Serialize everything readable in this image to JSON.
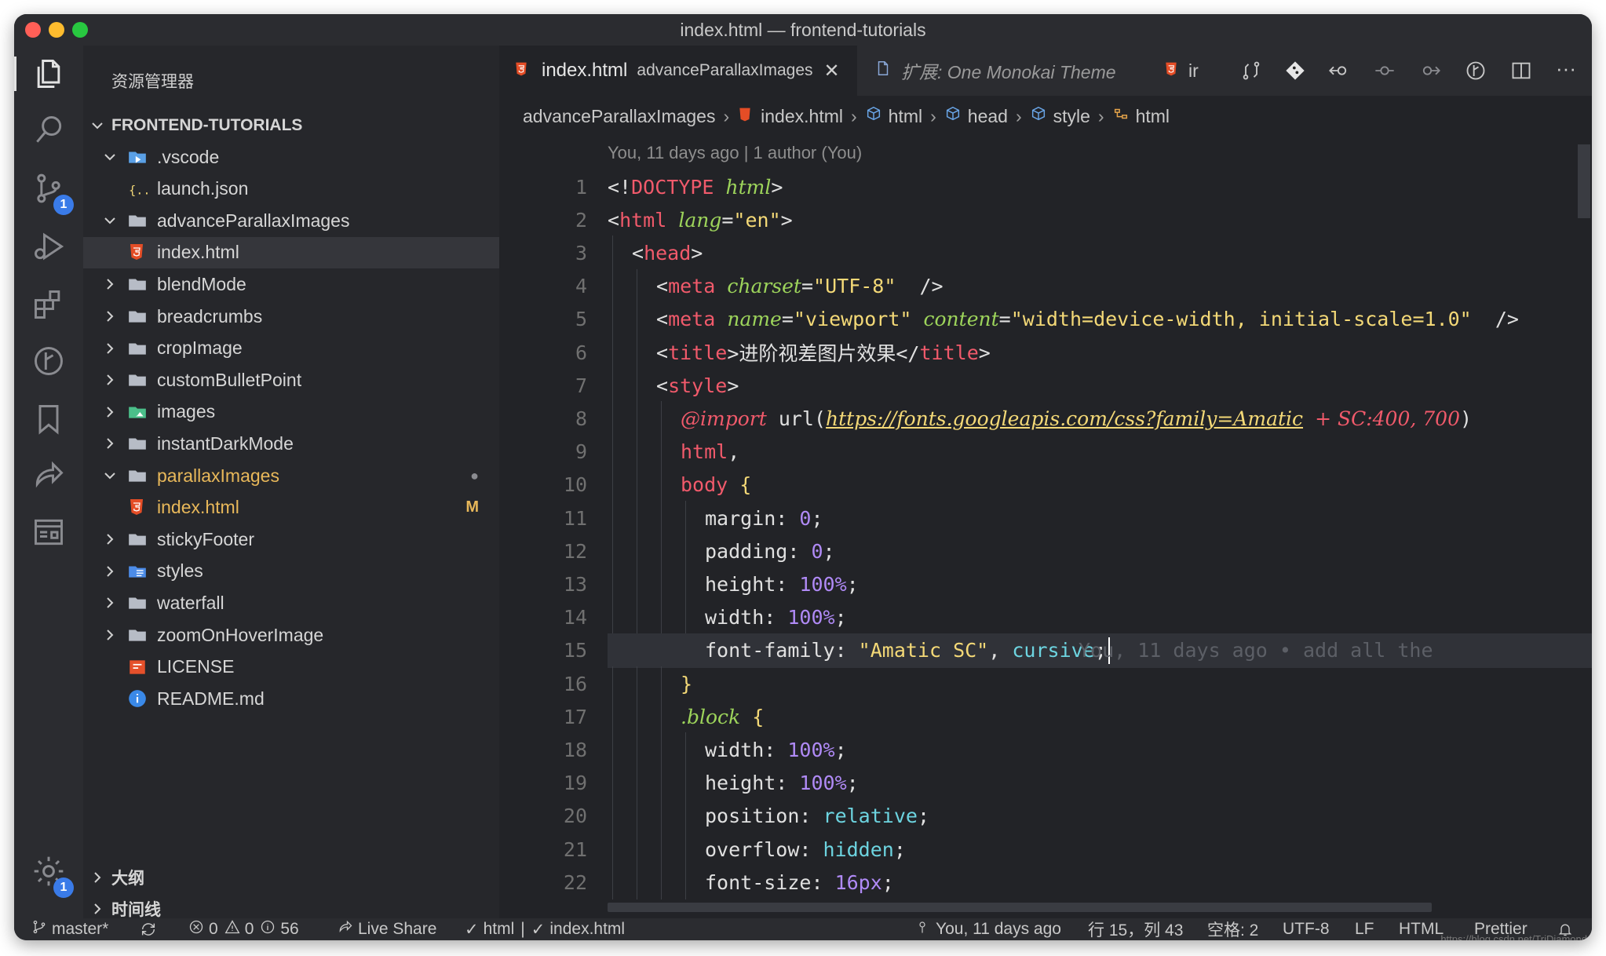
{
  "window": {
    "title": "index.html — frontend-tutorials"
  },
  "colors": {
    "accent": "#3a7be8",
    "traffic_red": "#ff5f57",
    "traffic_yellow": "#febc2e",
    "traffic_green": "#28c840",
    "html_icon": "#e44d26"
  },
  "activity": {
    "items": [
      "files-icon",
      "search-icon",
      "source-control-icon",
      "run-debug-icon",
      "extensions-icon",
      "git-graph-icon",
      "bookmarks-icon",
      "live-share-icon",
      "remote-explorer-icon",
      "settings-icon"
    ],
    "source_control_badge": "1",
    "settings_badge": "1"
  },
  "sidebar": {
    "title": "资源管理器",
    "root": "FRONTEND-TUTORIALS",
    "items": [
      {
        "label": ".vscode",
        "kind": "folder-vscode",
        "open": true,
        "level": 1
      },
      {
        "label": "launch.json",
        "kind": "json",
        "level": 2
      },
      {
        "label": "advanceParallaxImages",
        "kind": "folder",
        "open": true,
        "level": 1
      },
      {
        "label": "index.html",
        "kind": "html",
        "level": 2,
        "selected": true
      },
      {
        "label": "blendMode",
        "kind": "folder",
        "level": 1
      },
      {
        "label": "breadcrumbs",
        "kind": "folder",
        "level": 1
      },
      {
        "label": "cropImage",
        "kind": "folder",
        "level": 1
      },
      {
        "label": "customBulletPoint",
        "kind": "folder",
        "level": 1
      },
      {
        "label": "images",
        "kind": "folder-images",
        "level": 1
      },
      {
        "label": "instantDarkMode",
        "kind": "folder",
        "level": 1
      },
      {
        "label": "parallaxImages",
        "kind": "folder",
        "open": true,
        "level": 1,
        "modified": true,
        "dot": "●"
      },
      {
        "label": "index.html",
        "kind": "html",
        "level": 2,
        "modified": true,
        "mark": "M"
      },
      {
        "label": "stickyFooter",
        "kind": "folder",
        "level": 1
      },
      {
        "label": "styles",
        "kind": "folder-styles",
        "level": 1
      },
      {
        "label": "waterfall",
        "kind": "folder",
        "level": 1
      },
      {
        "label": "zoomOnHoverImage",
        "kind": "folder",
        "level": 1
      },
      {
        "label": "LICENSE",
        "kind": "license",
        "level": 1
      },
      {
        "label": "README.md",
        "kind": "info",
        "level": 1
      }
    ],
    "outline": "大纲",
    "timeline": "时间线"
  },
  "tabs": [
    {
      "label": "index.html",
      "description": "advanceParallaxImages",
      "active": true
    },
    {
      "label": "扩展: One Monokai Theme",
      "active": false
    },
    {
      "label": "ir",
      "active": false
    }
  ],
  "breadcrumb": [
    "advanceParallaxImages",
    "index.html",
    "html",
    "head",
    "style",
    "html"
  ],
  "editor": {
    "codelens": "You, 11 days ago | 1 author (You)",
    "current_line": 15,
    "blame": "You, 11 days ago • add all the",
    "lines": [
      {
        "n": "1",
        "indent": 0,
        "tokens": [
          [
            "p",
            "<!"
          ],
          [
            "t",
            "DOCTYPE"
          ],
          [
            "p",
            " "
          ],
          [
            "a",
            "html"
          ],
          [
            "p",
            ">"
          ]
        ]
      },
      {
        "n": "2",
        "indent": 0,
        "tokens": [
          [
            "p",
            "<"
          ],
          [
            "t",
            "html"
          ],
          [
            "p",
            " "
          ],
          [
            "a",
            "lang"
          ],
          [
            "p",
            "="
          ],
          [
            "s",
            "\"en\""
          ],
          [
            "p",
            ">"
          ]
        ]
      },
      {
        "n": "3",
        "indent": 1,
        "tokens": [
          [
            "p",
            "<"
          ],
          [
            "t",
            "head"
          ],
          [
            "p",
            ">"
          ]
        ]
      },
      {
        "n": "4",
        "indent": 2,
        "tokens": [
          [
            "p",
            "<"
          ],
          [
            "t",
            "meta"
          ],
          [
            "p",
            " "
          ],
          [
            "a",
            "charset"
          ],
          [
            "p",
            "="
          ],
          [
            "s",
            "\"UTF-8\""
          ],
          [
            "p",
            "  />"
          ]
        ]
      },
      {
        "n": "5",
        "indent": 2,
        "tokens": [
          [
            "p",
            "<"
          ],
          [
            "t",
            "meta"
          ],
          [
            "p",
            " "
          ],
          [
            "a",
            "name"
          ],
          [
            "p",
            "="
          ],
          [
            "s",
            "\"viewport\""
          ],
          [
            "p",
            " "
          ],
          [
            "a",
            "content"
          ],
          [
            "p",
            "="
          ],
          [
            "s",
            "\"width=device-width, initial-scale=1.0\""
          ],
          [
            "p",
            "  />"
          ]
        ]
      },
      {
        "n": "6",
        "indent": 2,
        "tokens": [
          [
            "p",
            "<"
          ],
          [
            "t",
            "title"
          ],
          [
            "p",
            ">进阶视差图片效果</"
          ],
          [
            "t",
            "title"
          ],
          [
            "p",
            ">"
          ]
        ]
      },
      {
        "n": "7",
        "indent": 2,
        "tokens": [
          [
            "p",
            "<"
          ],
          [
            "t",
            "style"
          ],
          [
            "p",
            ">"
          ]
        ]
      },
      {
        "n": "8",
        "indent": 3,
        "tokens": [
          [
            "k",
            "@import"
          ],
          [
            "p",
            " url("
          ],
          [
            "u",
            "https://fonts.googleapis.com/css?family=Amatic"
          ],
          [
            "p",
            " "
          ],
          [
            "d",
            "+ SC:400, 700"
          ],
          [
            "p",
            ")"
          ]
        ]
      },
      {
        "n": "9",
        "indent": 3,
        "tokens": [
          [
            "t",
            "html"
          ],
          [
            "p",
            ","
          ]
        ]
      },
      {
        "n": "10",
        "indent": 3,
        "tokens": [
          [
            "t",
            "body"
          ],
          [
            "p",
            " "
          ],
          [
            "br",
            "{"
          ]
        ]
      },
      {
        "n": "11",
        "indent": 4,
        "tokens": [
          [
            "p",
            "margin: "
          ],
          [
            "n",
            "0"
          ],
          [
            "p",
            ";"
          ]
        ]
      },
      {
        "n": "12",
        "indent": 4,
        "tokens": [
          [
            "p",
            "padding: "
          ],
          [
            "n",
            "0"
          ],
          [
            "p",
            ";"
          ]
        ]
      },
      {
        "n": "13",
        "indent": 4,
        "tokens": [
          [
            "p",
            "height: "
          ],
          [
            "n",
            "100%"
          ],
          [
            "p",
            ";"
          ]
        ]
      },
      {
        "n": "14",
        "indent": 4,
        "tokens": [
          [
            "p",
            "width: "
          ],
          [
            "n",
            "100%"
          ],
          [
            "p",
            ";"
          ]
        ]
      },
      {
        "n": "15",
        "indent": 4,
        "tokens": [
          [
            "p",
            "font-family: "
          ],
          [
            "s",
            "\"Amatic SC\""
          ],
          [
            "p",
            ", "
          ],
          [
            "c",
            "cursive"
          ],
          [
            "p",
            ";"
          ]
        ]
      },
      {
        "n": "16",
        "indent": 3,
        "tokens": [
          [
            "br",
            "}"
          ]
        ]
      },
      {
        "n": "17",
        "indent": 3,
        "tokens": [
          [
            "cls",
            ".block"
          ],
          [
            "p",
            " "
          ],
          [
            "br",
            "{"
          ]
        ]
      },
      {
        "n": "18",
        "indent": 4,
        "tokens": [
          [
            "p",
            "width: "
          ],
          [
            "n",
            "100%"
          ],
          [
            "p",
            ";"
          ]
        ]
      },
      {
        "n": "19",
        "indent": 4,
        "tokens": [
          [
            "p",
            "height: "
          ],
          [
            "n",
            "100%"
          ],
          [
            "p",
            ";"
          ]
        ]
      },
      {
        "n": "20",
        "indent": 4,
        "tokens": [
          [
            "p",
            "position: "
          ],
          [
            "c",
            "relative"
          ],
          [
            "p",
            ";"
          ]
        ]
      },
      {
        "n": "21",
        "indent": 4,
        "tokens": [
          [
            "p",
            "overflow: "
          ],
          [
            "c",
            "hidden"
          ],
          [
            "p",
            ";"
          ]
        ]
      },
      {
        "n": "22",
        "indent": 4,
        "tokens": [
          [
            "p",
            "font-size: "
          ],
          [
            "n",
            "16px"
          ],
          [
            "p",
            ";"
          ]
        ]
      }
    ]
  },
  "statusbar": {
    "branch": "master*",
    "errors": "0",
    "warnings": "0",
    "infos": "56",
    "live_share": "Live Share",
    "check_html": "html",
    "check_file": "index.html",
    "blame": "You, 11 days ago",
    "position": "行 15，列 43",
    "spaces": "空格: 2",
    "encoding": "UTF-8",
    "eol": "LF",
    "language": "HTML",
    "formatter": "Prettier",
    "watermark": "https://blog.csdn.net/TriDiamond"
  }
}
